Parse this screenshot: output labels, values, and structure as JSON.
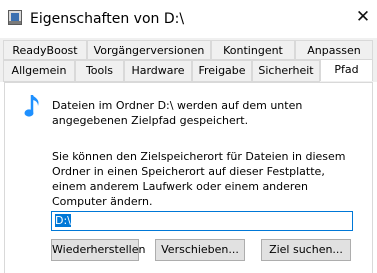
{
  "window": {
    "title": "Eigenschaften von D:\\",
    "close_glyph": "✕"
  },
  "tabs": {
    "row1": [
      "ReadyBoost",
      "Vorgängerversionen",
      "Kontingent",
      "Anpassen"
    ],
    "row2": [
      "Allgemein",
      "Tools",
      "Hardware",
      "Freigabe",
      "Sicherheit",
      "Pfad"
    ],
    "selected": "Pfad"
  },
  "content": {
    "description": "Dateien im Ordner D:\\ werden auf dem unten angegebenen Zielpfad gespeichert.",
    "instructions": "Sie können den Zielspeicherort für Dateien in diesem Ordner in einen Speicherort auf dieser Festplatte, einem anderem Laufwerk oder einem anderen Computer ändern.",
    "path_value": "D:\\"
  },
  "buttons": {
    "restore": "Wiederherstellen",
    "move": "Verschieben...",
    "find_target": "Ziel suchen..."
  },
  "icons": {
    "app": "drive-properties-icon",
    "folder": "music-note-icon",
    "close": "close-icon"
  },
  "colors": {
    "accent": "#0078d7",
    "note_icon": "#1e90ff"
  }
}
